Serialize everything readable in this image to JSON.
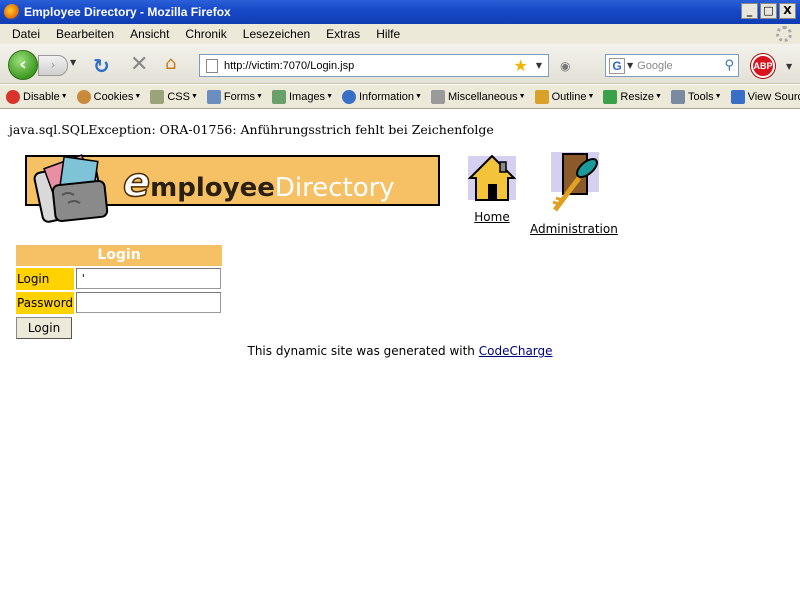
{
  "window": {
    "title": "Employee Directory - Mozilla Firefox",
    "buttons": {
      "minimize": "_",
      "maximize": "□",
      "close": "X"
    }
  },
  "menubar": {
    "items": [
      "Datei",
      "Bearbeiten",
      "Ansicht",
      "Chronik",
      "Lesezeichen",
      "Extras",
      "Hilfe"
    ]
  },
  "navbar": {
    "url": "http://victim:7070/Login.jsp",
    "search_placeholder": "Google"
  },
  "devbar": {
    "items": [
      {
        "label": "Disable",
        "icon": "disable-icon",
        "color": "#d9342b"
      },
      {
        "label": "Cookies",
        "icon": "cookies-icon",
        "color": "#c98a3a"
      },
      {
        "label": "CSS",
        "icon": "css-icon",
        "color": "#9aa37a"
      },
      {
        "label": "Forms",
        "icon": "forms-icon",
        "color": "#6a8fbf"
      },
      {
        "label": "Images",
        "icon": "images-icon",
        "color": "#6aa06a"
      },
      {
        "label": "Information",
        "icon": "information-icon",
        "color": "#3a6fc7"
      },
      {
        "label": "Miscellaneous",
        "icon": "miscellaneous-icon",
        "color": "#9a9a9a"
      },
      {
        "label": "Outline",
        "icon": "outline-icon",
        "color": "#d8a12a"
      },
      {
        "label": "Resize",
        "icon": "resize-icon",
        "color": "#3aa04a"
      },
      {
        "label": "Tools",
        "icon": "tools-icon",
        "color": "#7a8aa0"
      },
      {
        "label": "View Source",
        "icon": "view-source-icon",
        "color": "#3a6fc7"
      }
    ]
  },
  "page": {
    "error": "java.sql.SQLException: ORA-01756: Anführungsstrich fehlt bei Zeichenfolge",
    "banner": {
      "e": "e",
      "mployee": "mployee",
      "directory": "Directory"
    },
    "nav": {
      "home": "Home",
      "administration": "Administration"
    },
    "login": {
      "header": "Login",
      "login_label": "Login",
      "login_value": "'",
      "password_label": "Password",
      "password_value": "",
      "button": "Login"
    },
    "footer": {
      "text": "This dynamic site was generated with ",
      "link": "CodeCharge"
    }
  },
  "colors": {
    "banner_bg": "#f6c065",
    "label_bg": "#ffd200",
    "titlebar": "#1747c6"
  }
}
